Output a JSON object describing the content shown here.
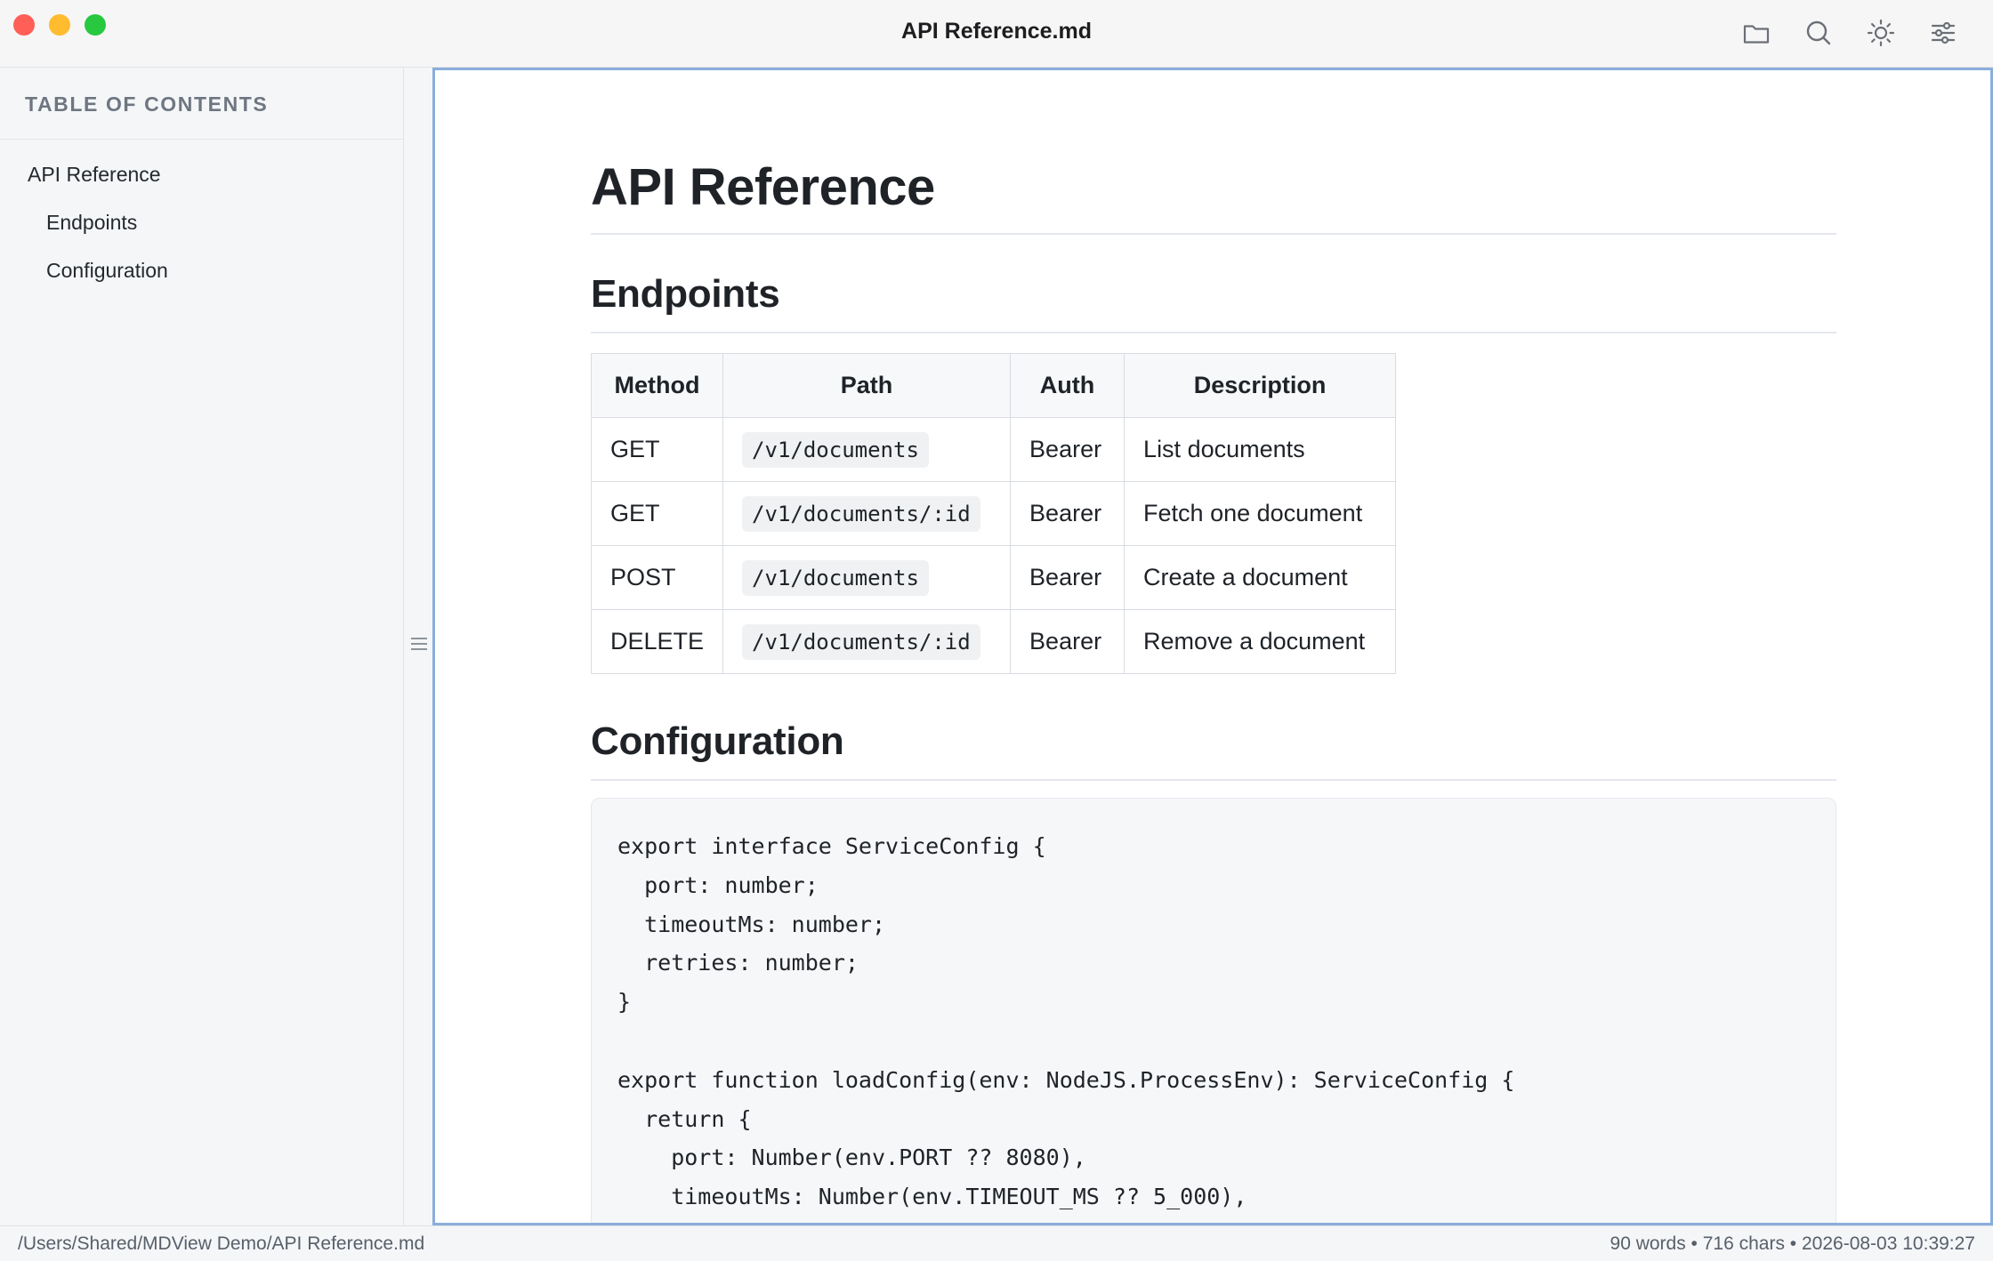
{
  "window": {
    "title": "API Reference.md"
  },
  "toolbar": {
    "icons": [
      "folder-icon",
      "search-icon",
      "sun-icon",
      "sliders-icon"
    ]
  },
  "sidebar": {
    "heading": "TABLE OF CONTENTS",
    "items": [
      {
        "label": "API Reference",
        "level": 1
      },
      {
        "label": "Endpoints",
        "level": 2
      },
      {
        "label": "Configuration",
        "level": 2
      }
    ]
  },
  "document": {
    "title": "API Reference",
    "sections": [
      {
        "heading": "Endpoints"
      },
      {
        "heading": "Configuration"
      }
    ],
    "table": {
      "headers": [
        "Method",
        "Path",
        "Auth",
        "Description"
      ],
      "rows": [
        {
          "method": "GET",
          "path": "/v1/documents",
          "auth": "Bearer",
          "description": "List documents"
        },
        {
          "method": "GET",
          "path": "/v1/documents/:id",
          "auth": "Bearer",
          "description": "Fetch one document"
        },
        {
          "method": "POST",
          "path": "/v1/documents",
          "auth": "Bearer",
          "description": "Create a document"
        },
        {
          "method": "DELETE",
          "path": "/v1/documents/:id",
          "auth": "Bearer",
          "description": "Remove a document"
        }
      ]
    },
    "code": "export interface ServiceConfig {\n  port: number;\n  timeoutMs: number;\n  retries: number;\n}\n\nexport function loadConfig(env: NodeJS.ProcessEnv): ServiceConfig {\n  return {\n    port: Number(env.PORT ?? 8080),\n    timeoutMs: Number(env.TIMEOUT_MS ?? 5_000),"
  },
  "status": {
    "path": "/Users/Shared/MDView Demo/API Reference.md",
    "stats": "90 words • 716 chars • 2026-08-03 10:39:27"
  },
  "colors": {
    "accent_border": "#8aaedb",
    "traffic_close": "#ff5f57",
    "traffic_minimize": "#febc2e",
    "traffic_maximize": "#28c840"
  }
}
